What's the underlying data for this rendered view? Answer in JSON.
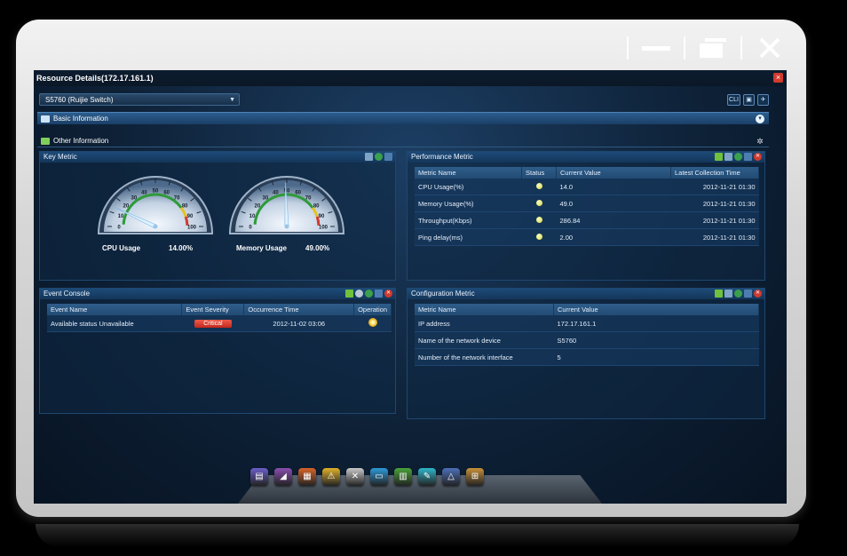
{
  "window": {
    "title": "Resource Details(172.17.161.1)",
    "close_glyph": "×",
    "controls": [
      "minimize-icon",
      "maximize-icon",
      "close-icon"
    ]
  },
  "device_selector": {
    "value": "S5760 (Ruijie Switch)"
  },
  "top_tools": [
    "CLI",
    "▣",
    "✈"
  ],
  "sections": {
    "basic": "Basic Information",
    "other": "Other Information"
  },
  "key_metric": {
    "title": "Key Metric",
    "gauges": [
      {
        "label": "CPU Usage",
        "value_text": "14.00%",
        "value": 14.0
      },
      {
        "label": "Memory Usage",
        "value_text": "49.00%",
        "value": 49.0
      }
    ],
    "ticks": [
      "0",
      "10",
      "20",
      "30",
      "40",
      "50",
      "60",
      "70",
      "80",
      "90",
      "100"
    ]
  },
  "performance_metric": {
    "title": "Performance Metric",
    "columns": [
      "Metric Name",
      "Status",
      "Current Value",
      "Latest Collection Time"
    ],
    "rows": [
      [
        "CPU Usage(%)",
        "",
        "14.0",
        "2012-11-21 01:30"
      ],
      [
        "Memory Usage(%)",
        "",
        "49.0",
        "2012-11-21 01:30"
      ],
      [
        "Throughput(Kbps)",
        "",
        "286.84",
        "2012-11-21 01:30"
      ],
      [
        "Ping delay(ms)",
        "",
        "2.00",
        "2012-11-21 01:30"
      ]
    ]
  },
  "event_console": {
    "title": "Event Console",
    "columns": [
      "Event Name",
      "Event Severity",
      "Occurrence Time",
      "Operation"
    ],
    "rows": [
      [
        "Available status Unavailable",
        "Critical",
        "2012-11-02 03:06",
        ""
      ]
    ]
  },
  "configuration_metric": {
    "title": "Configuration Metric",
    "columns": [
      "Metric Name",
      "Current Value"
    ],
    "rows": [
      [
        "IP address",
        "172.17.161.1"
      ],
      [
        "Name of the network device",
        "S5760"
      ],
      [
        "Number of the network interface",
        "5"
      ]
    ]
  },
  "dock": {
    "icons": [
      {
        "name": "resource-icon",
        "color": "#6b5fc9",
        "glyph": "▤"
      },
      {
        "name": "chart-icon",
        "color": "#8a4fb0",
        "glyph": "◢"
      },
      {
        "name": "report-icon",
        "color": "#d8642a",
        "glyph": "▦"
      },
      {
        "name": "alarm-icon",
        "color": "#e0b12a",
        "glyph": "⚠"
      },
      {
        "name": "tools-icon",
        "color": "#c9c9c9",
        "glyph": "✕"
      },
      {
        "name": "monitor-icon",
        "color": "#2d9ad8",
        "glyph": "▭"
      },
      {
        "name": "statistics-icon",
        "color": "#4aa33b",
        "glyph": "▥"
      },
      {
        "name": "config-icon",
        "color": "#2fb6c9",
        "glyph": "✎"
      },
      {
        "name": "topology-icon",
        "color": "#4d6fb8",
        "glyph": "△"
      },
      {
        "name": "system-icon",
        "color": "#c9913a",
        "glyph": "⊞"
      }
    ]
  }
}
